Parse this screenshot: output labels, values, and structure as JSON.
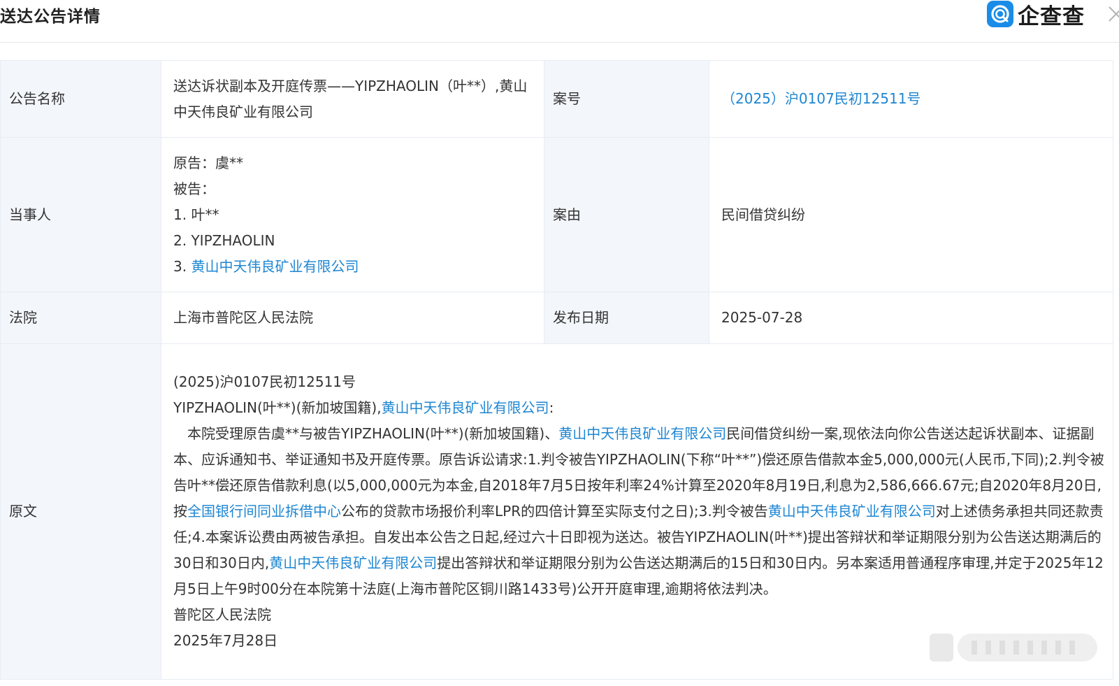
{
  "header": {
    "title": "送达公告详情",
    "brand": {
      "name": "企查查",
      "brand_color": "#1a8ce8",
      "logo_icon": "qichacha-logo-icon"
    },
    "close_icon": "close-icon"
  },
  "detail": {
    "title_label": "公告名称",
    "title_value": "送达诉状副本及开庭传票——YIPZHAOLIN（叶**）,黄山中天伟良矿业有限公司",
    "case_no_label": "案号",
    "case_no_value": "（2025）沪0107民初12511号",
    "party_label": "当事人",
    "plaintiff_line": "原告：虞**",
    "defendant_line": "被告：",
    "defendants": [
      {
        "prefix": "1. ",
        "name": "叶**",
        "link": false
      },
      {
        "prefix": "2. ",
        "name": "YIPZHAOLIN",
        "link": false
      },
      {
        "prefix": "3. ",
        "name": "黄山中天伟良矿业有限公司",
        "link": true
      }
    ],
    "cause_label": "案由",
    "cause_value": "民间借贷纠纷",
    "court_label": "法院",
    "court_value": "上海市普陀区人民法院",
    "date_label": "发布日期",
    "date_value": "2025-07-28",
    "text_label": "原文",
    "text": {
      "case_line": "(2025)沪0107民初12511号",
      "addressee_prefix": "YIPZHAOLIN(叶**)(新加坡国籍),",
      "addressee_company": "黄山中天伟良矿业有限公司",
      "addressee_suffix": ":",
      "p1": "　本院受理原告虞**与被告YIPZHAOLIN(叶**)(新加坡国籍)、",
      "p1_link": "黄山中天伟良矿业有限公司",
      "p2": "民间借贷纠纷一案,现依法向你公告送达起诉状副本、证据副本、应诉通知书、举证通知书及开庭传票。原告诉讼请求:1.判令被告YIPZHAOLIN(下称“叶**”)偿还原告借款本金5,000,000元(人民币,下同);2.判令被告叶**偿还原告借款利息(以5,000,000元为本金,自2018年7月5日按年利率24%计算至2020年8月19日,利息为2,586,666.67元;自2020年8月20日,按",
      "p2_link": "全国银行间同业拆借中心",
      "p3": "公布的贷款市场报价利率LPR的四倍计算至实际支付之日);3.判令被告",
      "p3_link": "黄山中天伟良矿业有限公司",
      "p4": "对上述债务承担共同还款责任;4.本案诉讼费由两被告承担。自发出本公告之日起,经过六十日即视为送达。被告YIPZHAOLIN(叶**)提出答辩状和举证期限分别为公告送达期满后的30日和30日内,",
      "p4_link": "黄山中天伟良矿业有限公司",
      "p5": "提出答辩状和举证期限分别为公告送达期满后的15日和30日内。另本案适用普通程序审理,并定于2025年12月5日上午9时00分在本院第十法庭(上海市普陀区铜川路1433号)公开开庭审理,逾期将依法判决。",
      "signature": "普陀区人民法院",
      "sign_date": "2025年7月28日"
    }
  },
  "colors": {
    "label_bg": "#f3f6fb",
    "border": "#e7edf4",
    "link": "#1e86d2",
    "text": "#333333"
  }
}
